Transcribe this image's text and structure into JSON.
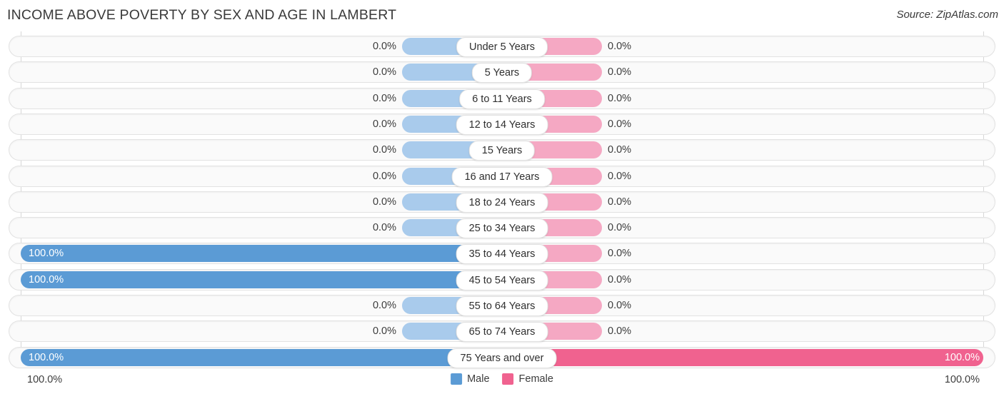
{
  "header": {
    "title": "INCOME ABOVE POVERTY BY SEX AND AGE IN LAMBERT",
    "source": "Source: ZipAtlas.com"
  },
  "legend": {
    "male_label": "Male",
    "female_label": "Female",
    "male_color": "#5b9bd5",
    "female_color": "#f0628f"
  },
  "axis": {
    "left_end_label": "100.0%",
    "right_end_label": "100.0%",
    "max": 100
  },
  "colors": {
    "male_zero": "#a9cbec",
    "female_zero": "#f5a8c3",
    "male_full": "#5b9bd5",
    "female_full": "#f0628f",
    "track": "#fafafa",
    "track_border": "#e2e2e2"
  },
  "chart_data": {
    "type": "bar",
    "subtype": "diverging-bidirectional-bar",
    "title": "INCOME ABOVE POVERTY BY SEX AND AGE IN LAMBERT",
    "xlabel": "",
    "ylabel": "",
    "xlim": [
      0,
      100
    ],
    "grid": false,
    "legend_position": "bottom-center",
    "categories": [
      "Under 5 Years",
      "5 Years",
      "6 to 11 Years",
      "12 to 14 Years",
      "15 Years",
      "16 and 17 Years",
      "18 to 24 Years",
      "25 to 34 Years",
      "35 to 44 Years",
      "45 to 54 Years",
      "55 to 64 Years",
      "65 to 74 Years",
      "75 Years and over"
    ],
    "series": [
      {
        "name": "Male",
        "direction": "left",
        "values": [
          0.0,
          0.0,
          0.0,
          0.0,
          0.0,
          0.0,
          0.0,
          0.0,
          100.0,
          100.0,
          0.0,
          0.0,
          100.0
        ],
        "labels": [
          "0.0%",
          "0.0%",
          "0.0%",
          "0.0%",
          "0.0%",
          "0.0%",
          "0.0%",
          "0.0%",
          "100.0%",
          "100.0%",
          "0.0%",
          "0.0%",
          "100.0%"
        ]
      },
      {
        "name": "Female",
        "direction": "right",
        "values": [
          0.0,
          0.0,
          0.0,
          0.0,
          0.0,
          0.0,
          0.0,
          0.0,
          0.0,
          0.0,
          0.0,
          0.0,
          100.0
        ],
        "labels": [
          "0.0%",
          "0.0%",
          "0.0%",
          "0.0%",
          "0.0%",
          "0.0%",
          "0.0%",
          "0.0%",
          "0.0%",
          "0.0%",
          "0.0%",
          "0.0%",
          "100.0%"
        ]
      }
    ]
  }
}
